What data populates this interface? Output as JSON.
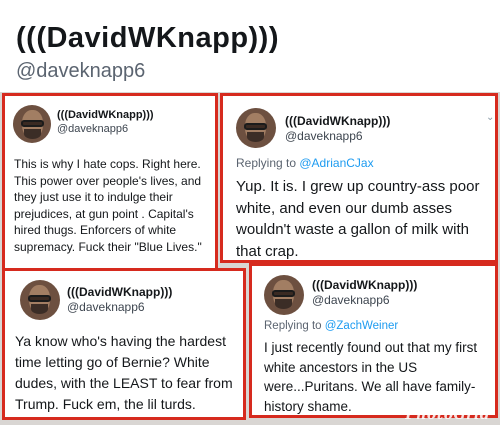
{
  "profile": {
    "display_name": "(((DavidWKnapp)))",
    "handle": "@daveknapp6"
  },
  "tweets": [
    {
      "display_name": "(((DavidWKnapp)))",
      "handle": "@daveknapp6",
      "text": "This is why I hate cops. Right here. This power over people's lives, and they just use it to indulge their prejudices, at gun point . Capital's hired thugs. Enforcers of white supremacy. Fuck their \"Blue Lives.\""
    },
    {
      "display_name": "(((DavidWKnapp)))",
      "handle": "@daveknapp6",
      "replying_prefix": "Replying to ",
      "replying_to": "@AdrianCJax",
      "text": "Yup. It is. I grew up country-ass poor white, and even our dumb asses wouldn't waste a gallon of milk with that crap."
    },
    {
      "display_name": "(((DavidWKnapp)))",
      "handle": "@daveknapp6",
      "text": "Ya know who's having the hardest time letting go of Bernie? White dudes, with the LEAST to fear from Trump. Fuck em, the lil turds."
    },
    {
      "display_name": "(((DavidWKnapp)))",
      "handle": "@daveknapp6",
      "replying_prefix": "Replying to ",
      "replying_to": "@ZachWeiner",
      "text": "I just recently found out that my first white ancestors in the US were...Puritans. We all have family-history shame."
    }
  ],
  "watermark": "PhotoGrid",
  "colors": {
    "border": "#d62a1e",
    "mention": "#1d9bf0",
    "background": "#d9d6d3"
  },
  "icons": {
    "more": "chevron-down-icon"
  }
}
